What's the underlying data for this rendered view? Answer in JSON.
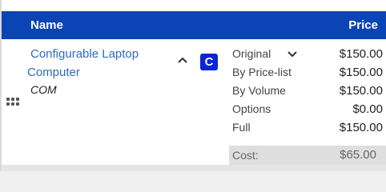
{
  "header": {
    "name_label": "Name",
    "price_label": "Price"
  },
  "product": {
    "title_line1": "Configurable Laptop",
    "title_line2": "Computer",
    "sku": "COM",
    "badge": "C"
  },
  "prices": [
    {
      "label": "Original",
      "value": "$150.00"
    },
    {
      "label": "By Price-list",
      "value": "$150.00"
    },
    {
      "label": "By Volume",
      "value": "$150.00"
    },
    {
      "label": "Options",
      "value": "$0.00"
    },
    {
      "label": "Full",
      "value": "$150.00"
    }
  ],
  "cost": {
    "label": "Cost:",
    "value": "$65.00"
  },
  "icons": {
    "drag": "drag-handle-icon",
    "collapse": "chevron-up-icon",
    "dropdown": "chevron-down-icon"
  },
  "colors": {
    "header_bg": "#0d44b5",
    "link": "#2d6bbf",
    "badge_bg": "#0a24d6"
  }
}
